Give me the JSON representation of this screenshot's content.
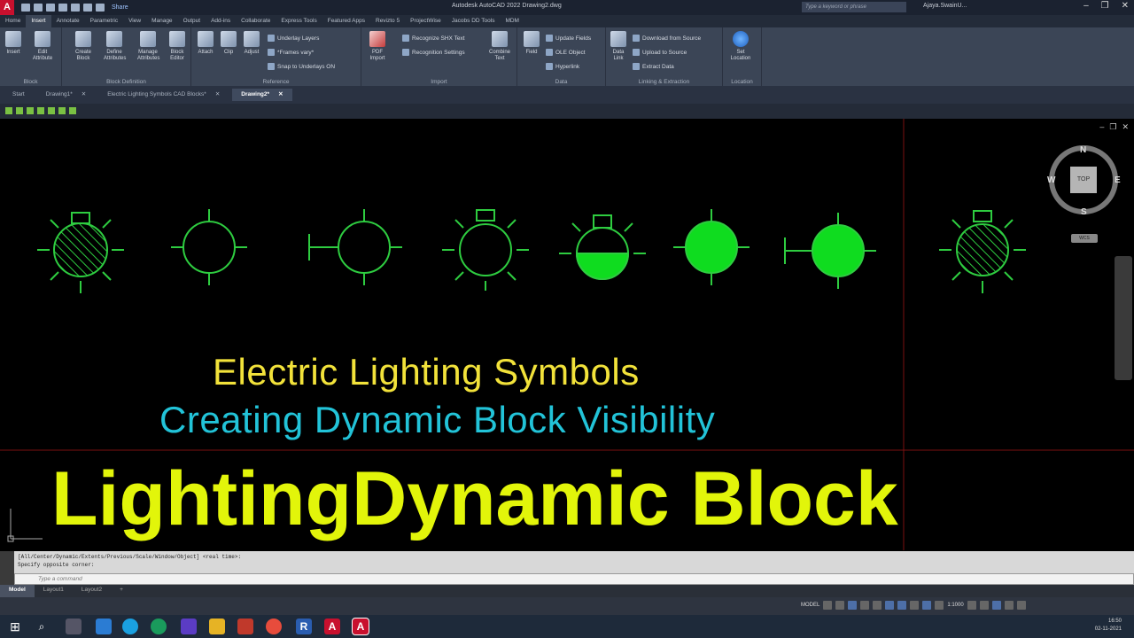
{
  "titlebar": {
    "logo": "A",
    "share": "Share",
    "app_title": "Autodesk AutoCAD 2022    Drawing2.dwg",
    "search_placeholder": "Type a keyword or phrase",
    "user": "Ajaya.SwainU..."
  },
  "ribbon_tabs": [
    "Home",
    "Insert",
    "Annotate",
    "Parametric",
    "View",
    "Manage",
    "Output",
    "Add-ins",
    "Collaborate",
    "Express Tools",
    "Featured Apps",
    "Revizto 5",
    "ProjectWise",
    "Jacobs DD Tools",
    "MDM"
  ],
  "ribbon_active_tab": "Insert",
  "ribbon": {
    "block": {
      "insert": "Insert",
      "edit_attribute": "Edit Attribute",
      "label": "Block"
    },
    "block_definition": {
      "create_block": "Create Block",
      "define_attributes": "Define Attributes",
      "manage_attributes": "Manage Attributes",
      "block_editor": "Block Editor",
      "label": "Block Definition"
    },
    "reference": {
      "attach": "Attach",
      "clip": "Clip",
      "adjust": "Adjust",
      "underlay_layers": "Underlay Layers",
      "frames": "*Frames vary*",
      "snap": "Snap to Underlays ON",
      "label": "Reference"
    },
    "import": {
      "pdf_import": "PDF Import",
      "recognize_shx": "Recognize SHX Text",
      "recognition_settings": "Recognition Settings",
      "combine_text": "Combine Text",
      "label": "Import"
    },
    "data": {
      "field": "Field",
      "update_fields": "Update Fields",
      "ole_object": "OLE Object",
      "hyperlink": "Hyperlink",
      "label": "Data"
    },
    "linking": {
      "data_link": "Data Link",
      "download": "Download from Source",
      "upload": "Upload to Source",
      "extract": "Extract Data",
      "label": "Linking & Extraction"
    },
    "location": {
      "set_location": "Set Location",
      "label": "Location"
    }
  },
  "doc_tabs": [
    "Start",
    "Drawing1*",
    "Electric Lighting Symbols CAD Blocks*",
    "Drawing2*"
  ],
  "doc_active": "Drawing2*",
  "canvas": {
    "heading1": "Electric Lighting Symbols",
    "heading2": "Creating Dynamic Block Visibility",
    "overlay_title": "LightingDynamic Block"
  },
  "viewcube": {
    "n": "N",
    "s": "S",
    "e": "E",
    "w": "W",
    "top": "TOP",
    "wcs": "WCS"
  },
  "command": {
    "history1": "[All/Center/Dynamic/Extents/Previous/Scale/Window/Object] <real time>:",
    "history2": "Specify opposite corner:",
    "placeholder": "Type a command"
  },
  "layout_tabs": [
    "Model",
    "Layout1",
    "Layout2",
    "+"
  ],
  "layout_active": "Model",
  "status": {
    "model": "MODEL",
    "scale": "1:1000"
  },
  "clock": {
    "time": "16:50",
    "date": "02-11-2021"
  },
  "colors": {
    "symbol_green": "#2ecc40",
    "fill_green": "#0fdc1f",
    "heading1": "#f2e23a",
    "heading2": "#22c3d8",
    "overlay": "#e2f50a"
  }
}
